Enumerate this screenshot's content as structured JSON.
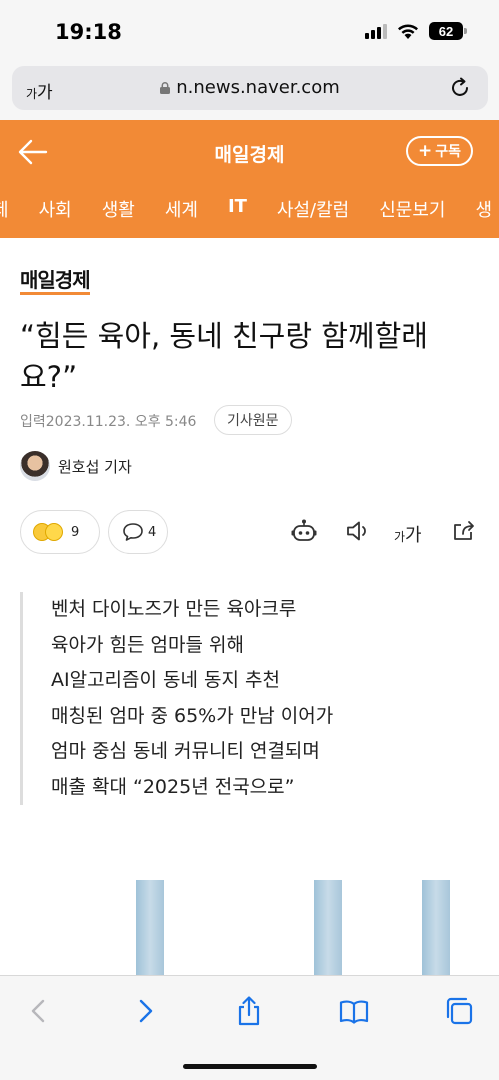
{
  "status": {
    "time": "19:18",
    "battery": "62",
    "icons": [
      "signal-icon",
      "wifi-icon",
      "battery-icon"
    ]
  },
  "browser": {
    "text_size_label_small": "가",
    "text_size_label_large": "가",
    "url": "n.news.naver.com"
  },
  "header": {
    "title": "매일경제",
    "subscribe_label": "구독",
    "categories": [
      "제",
      "사회",
      "생활",
      "세계",
      "IT",
      "사설/칼럼",
      "신문보기",
      "생"
    ],
    "active_category": "IT",
    "color": "#f28a36"
  },
  "article": {
    "press": "매일경제",
    "title": "“힘든 육아, 동네 친구랑 함께할래요?”",
    "date": "입력2023.11.23. 오후 5:46",
    "original_label": "기사원문",
    "author": "원호섭 기자",
    "reaction_count": "9",
    "comment_count": "4",
    "text_size_small": "가",
    "text_size_large": "가",
    "summary": [
      "벤처 다이노즈가 만든 육아크루",
      "육아가 힘든 엄마들 위해",
      "AI알고리즘이 동네 동지 추천",
      "매칭된 엄마 중 65%가 만남 이어가",
      "엄마 중심 동네 커뮤니티 연결되며",
      "매출 확대 “2025년 전국으로”"
    ]
  },
  "toolbar": {
    "items": [
      "back-icon",
      "forward-icon",
      "share-icon",
      "bookmarks-icon",
      "tabs-icon"
    ]
  }
}
